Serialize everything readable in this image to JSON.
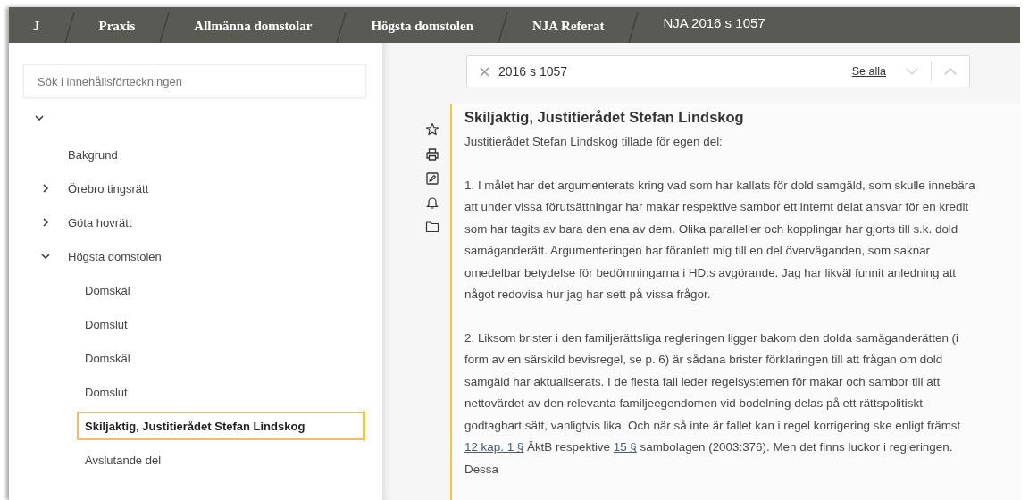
{
  "breadcrumbs": [
    {
      "label": "J",
      "current": false
    },
    {
      "label": "Praxis",
      "current": false
    },
    {
      "label": "Allmänna domstolar",
      "current": false
    },
    {
      "label": "Högsta domstolen",
      "current": false
    },
    {
      "label": "NJA Referat",
      "current": false
    },
    {
      "label": "NJA 2016 s 1057",
      "current": true
    }
  ],
  "sidebar": {
    "search": {
      "placeholder": "Sök i innehållsförteckningen"
    },
    "tree": {
      "expanded": true,
      "children": [
        {
          "label": "Bakgrund",
          "selected": false
        },
        {
          "label": "Örebro tingsrätt",
          "expanded": false,
          "selected": false
        },
        {
          "label": "Göta hovrätt",
          "expanded": false,
          "selected": false
        },
        {
          "label": "Högsta domstolen",
          "expanded": true,
          "selected": false,
          "children": [
            {
              "label": "Domskäl",
              "selected": false
            },
            {
              "label": "Domslut",
              "selected": false
            },
            {
              "label": "Domskäl",
              "selected": false
            },
            {
              "label": "Domslut",
              "selected": false
            },
            {
              "label": "Skiljaktig, Justitierådet Stefan Lindskog",
              "selected": true
            },
            {
              "label": "Avslutande del",
              "selected": false
            }
          ]
        }
      ]
    }
  },
  "find_bar": {
    "value": "2016 s 1057",
    "see_all": "Se alla"
  },
  "article": {
    "title": "Skiljaktig, Justitierådet Stefan Lindskog",
    "paragraphs": [
      {
        "parts": [
          {
            "kind": "text",
            "text": "Justitierådet Stefan Lindskog tillade för egen del:"
          }
        ]
      },
      {
        "parts": [
          {
            "kind": "text",
            "text": "1. I målet har det argumenterats kring vad som har kallats för dold samgäld, som skulle innebära att under vissa förutsättningar har makar respektive sambor ett internt delat ansvar för en kredit som har tagits av bara den ena av dem. Olika paralleller och kopplingar har gjorts till s.k. dold samäganderätt. Argumenteringen har föranlett mig till en del överväganden, som saknar omedelbar betydelse för bedömningarna i HD:s avgörande. Jag har likväl funnit anledning att något redovisa hur jag har sett på vissa frågor."
          }
        ]
      },
      {
        "parts": [
          {
            "kind": "text",
            "text": "2. Liksom brister i den familjerättsliga regleringen ligger bakom den dolda samäganderätten (i form av en särskild bevisregel, se p. 6) är sådana brister förklaringen till att frågan om dold samgäld har aktualiserats. I de flesta fall leder regelsystemen för makar och sambor till att nettovärdet av den relevanta familjeegendomen vid bodelning delas på ett rättspolitiskt godtagbart sätt, vanligtvis lika. Och när så inte är fallet kan i regel korrigering ske enligt främst "
          },
          {
            "kind": "link",
            "text": "12 kap. 1 §"
          },
          {
            "kind": "text",
            "text": " ÄktB respektive "
          },
          {
            "kind": "link",
            "text": "15 §"
          },
          {
            "kind": "text",
            "text": " sambolagen (2003:376). Men det finns luckor i regleringen. Dessa"
          }
        ]
      }
    ]
  }
}
